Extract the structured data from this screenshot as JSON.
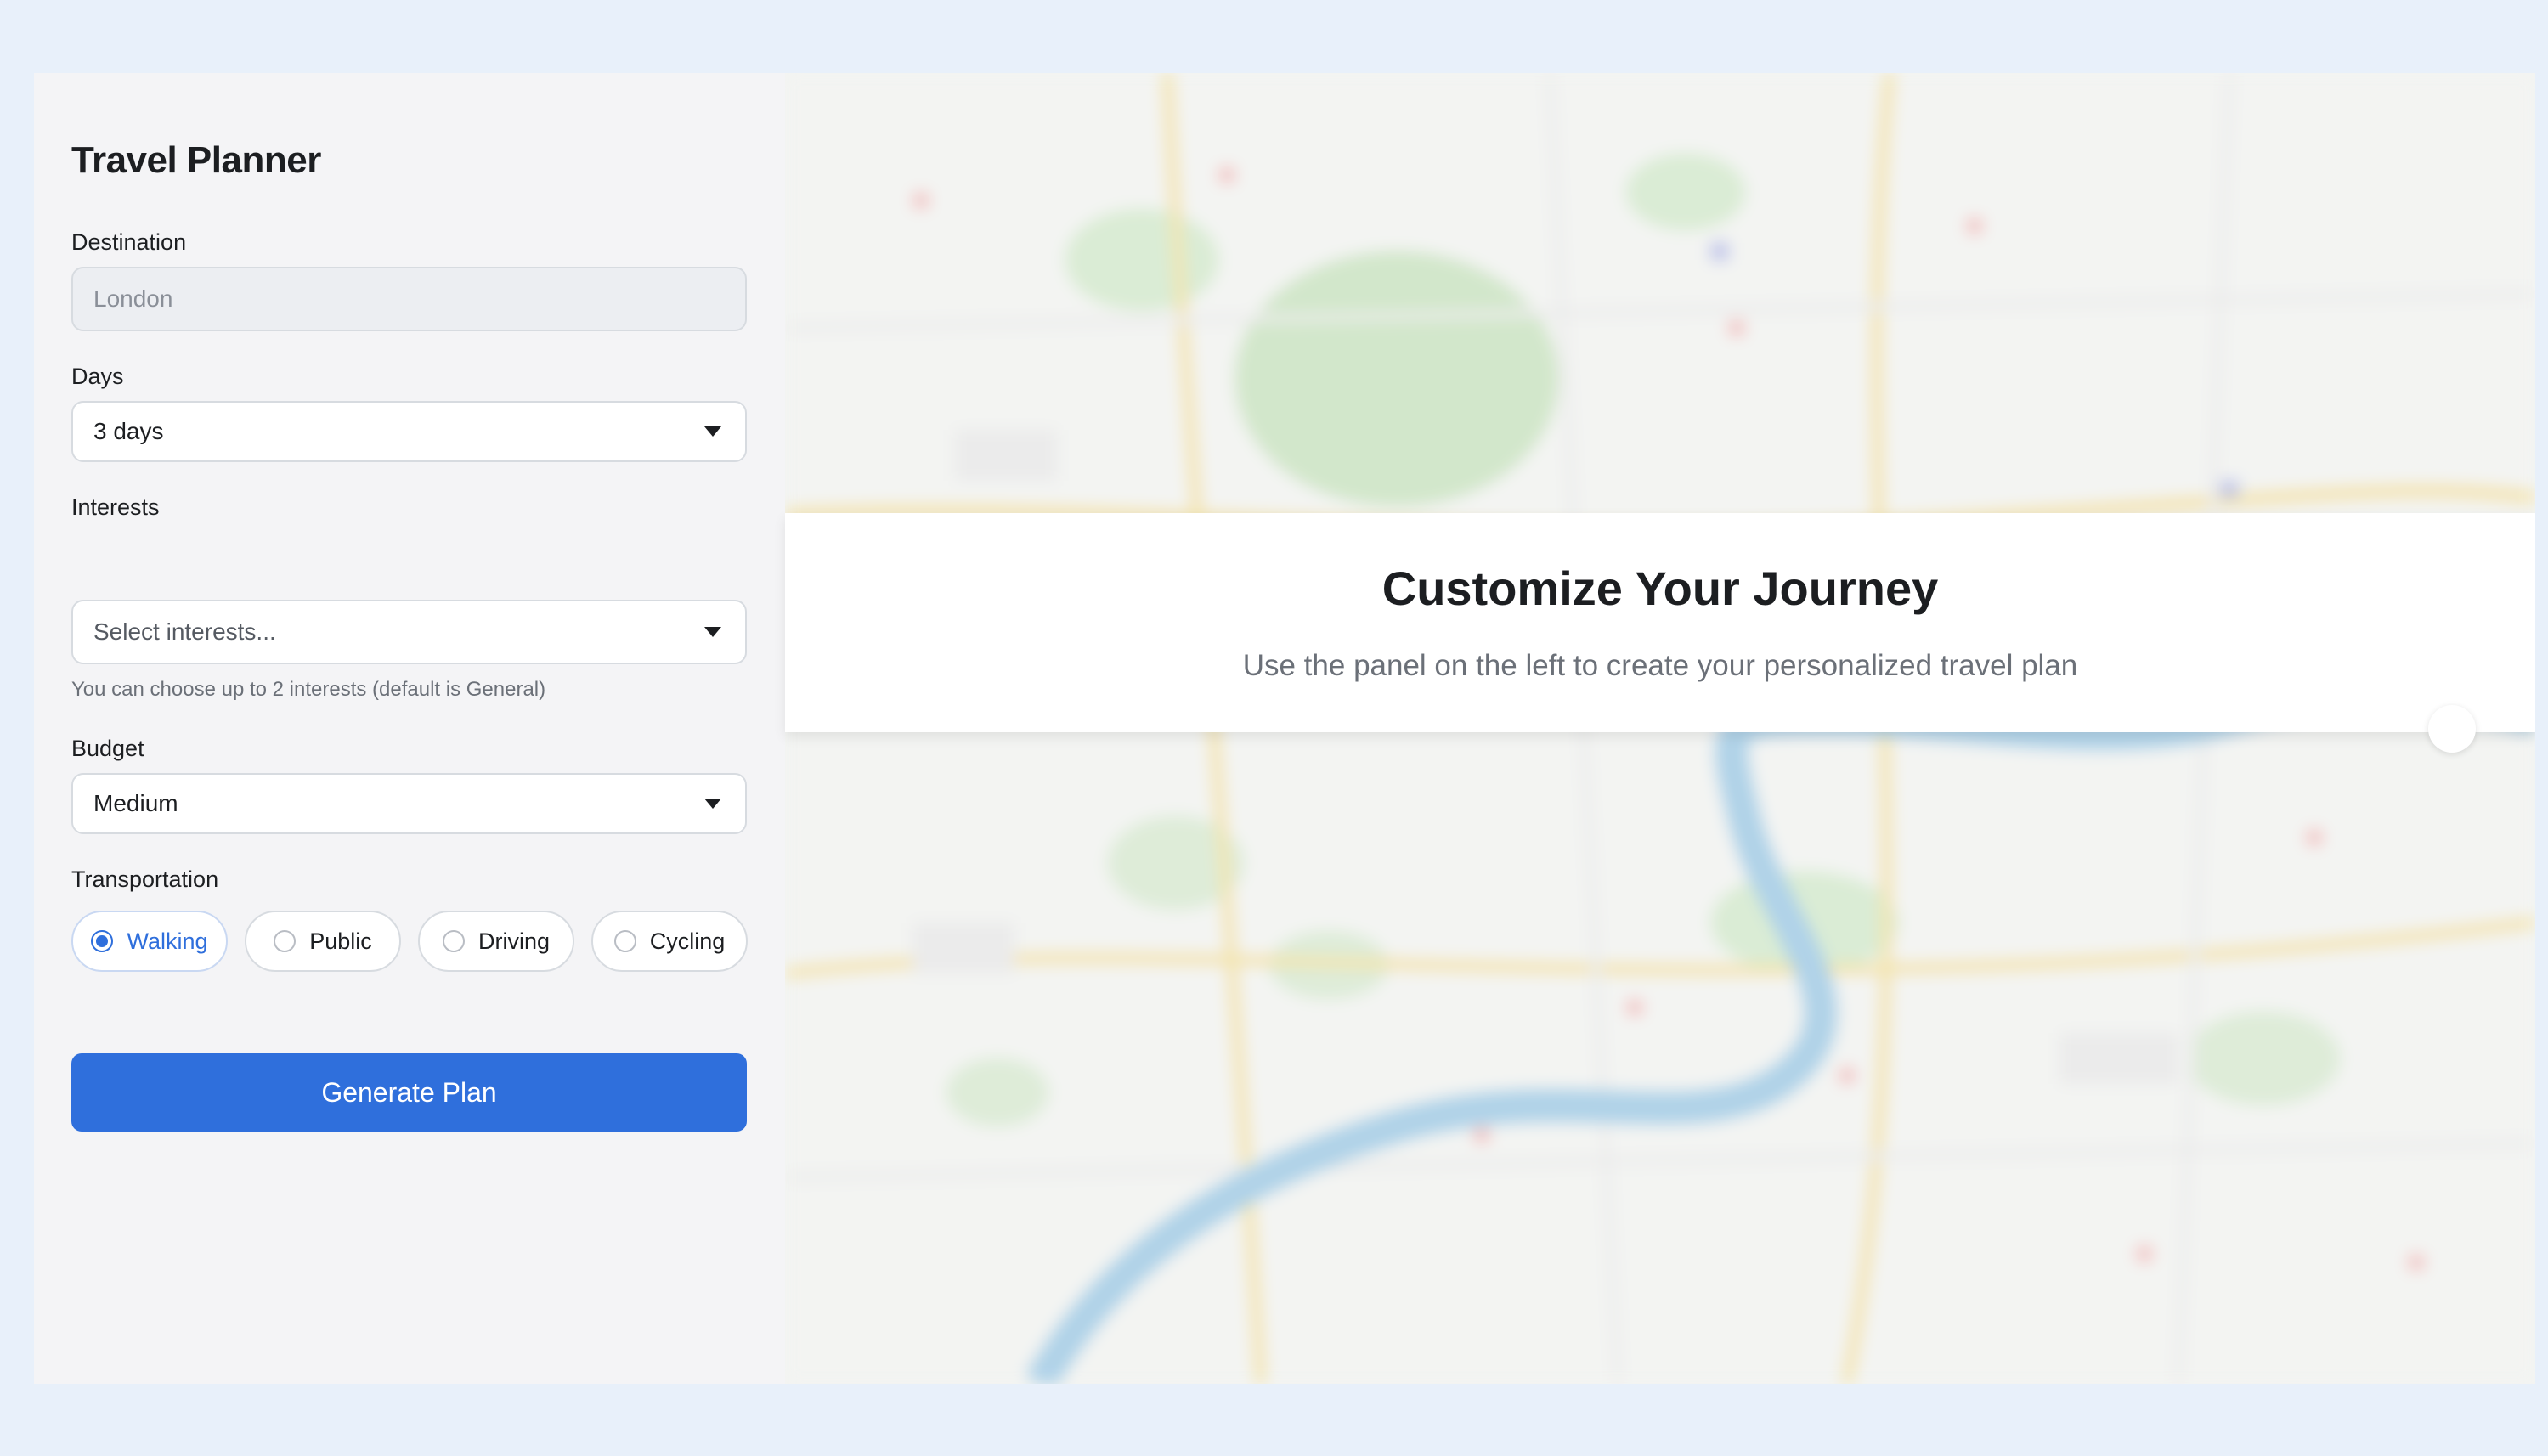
{
  "panel": {
    "title": "Travel Planner",
    "destination": {
      "label": "Destination",
      "value": "London"
    },
    "days": {
      "label": "Days",
      "selected": "3 days"
    },
    "interests": {
      "label": "Interests",
      "placeholder": "Select interests...",
      "hint": "You can choose up to 2 interests (default is General)"
    },
    "budget": {
      "label": "Budget",
      "selected": "Medium"
    },
    "transportation": {
      "label": "Transportation",
      "options": [
        {
          "label": "Walking",
          "selected": true
        },
        {
          "label": "Public",
          "selected": false
        },
        {
          "label": "Driving",
          "selected": false
        },
        {
          "label": "Cycling",
          "selected": false
        }
      ]
    },
    "generate_label": "Generate Plan"
  },
  "banner": {
    "title": "Customize Your Journey",
    "subtitle": "Use the panel on the left to create your personalized travel plan"
  },
  "colors": {
    "accent": "#2f6fdc",
    "page_bg": "#e8f0fa",
    "panel_bg": "#f4f4f6"
  }
}
